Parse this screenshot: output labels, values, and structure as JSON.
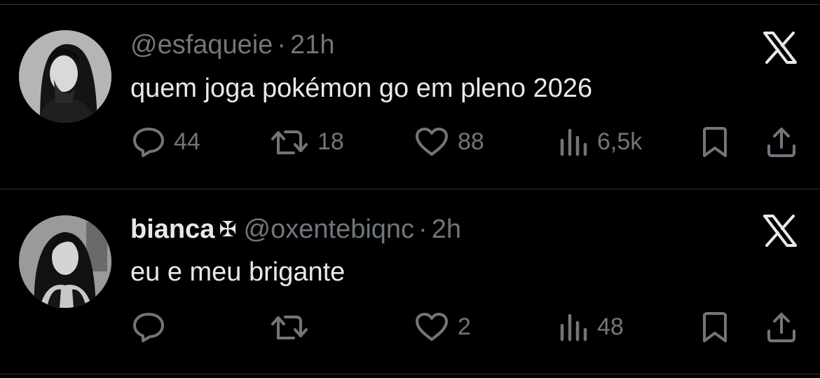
{
  "tweets": [
    {
      "display_name": "",
      "badge": "",
      "handle": "@esfaqueie",
      "separator": "·",
      "time": "21h",
      "text": "quem joga pokémon go em pleno 2026",
      "reply_count": "44",
      "retweet_count": "18",
      "like_count": "88",
      "view_count": "6,5k",
      "avatar_icon": "avatar-photo",
      "logo_icon": "x-logo-icon"
    },
    {
      "display_name": "bianca",
      "badge": "✠",
      "handle": "@oxentebiqnc",
      "separator": "·",
      "time": "2h",
      "text": "eu e meu brigante",
      "reply_count": "",
      "retweet_count": "",
      "like_count": "2",
      "view_count": "48",
      "avatar_icon": "avatar-photo",
      "logo_icon": "x-logo-icon"
    }
  ],
  "icons": [
    "reply-icon",
    "retweet-icon",
    "like-icon",
    "views-icon",
    "bookmark-icon",
    "share-icon",
    "x-logo-icon"
  ],
  "colors": {
    "background": "#000000",
    "text_primary": "#e7e9ea",
    "text_secondary": "#71767b",
    "divider": "#2f3336"
  }
}
